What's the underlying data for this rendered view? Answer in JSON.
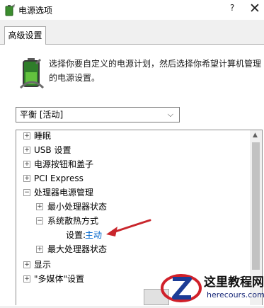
{
  "window": {
    "title": "电源选项",
    "help_label": "?",
    "close_label": "✕"
  },
  "tabs": [
    {
      "label": "高级设置"
    }
  ],
  "description": "选择你要自定义的电源计划，然后选择你希望计算机管理的电源设置。",
  "plan_select": {
    "value": "平衡 [活动]",
    "chevron": "⌵"
  },
  "tree": {
    "items": [
      {
        "label": "睡眠",
        "expander": "+",
        "level": 0
      },
      {
        "label": "USB 设置",
        "expander": "+",
        "level": 0
      },
      {
        "label": "电源按钮和盖子",
        "expander": "+",
        "level": 0
      },
      {
        "label": "PCI Express",
        "expander": "+",
        "level": 0
      },
      {
        "label": "处理器电源管理",
        "expander": "−",
        "level": 0
      },
      {
        "label": "最小处理器状态",
        "expander": "+",
        "level": 1
      },
      {
        "label": "系统散热方式",
        "expander": "−",
        "level": 1
      },
      {
        "label": "设置:",
        "value": "主动",
        "level": 2
      },
      {
        "label": "最大处理器状态",
        "expander": "+",
        "level": 1
      },
      {
        "label": "显示",
        "expander": "+",
        "level": 0
      },
      {
        "label": "\"多媒体\"设置",
        "expander": "+",
        "level": 0
      }
    ]
  },
  "scrollbar": {
    "up_glyph": "▲"
  },
  "watermark": {
    "title": "这里教程网",
    "subtitle": "herecours.com"
  },
  "colors": {
    "setting_value": "#0066cc",
    "annotation_arrow": "#c9262c",
    "tree_border": "#8d8d8d"
  }
}
